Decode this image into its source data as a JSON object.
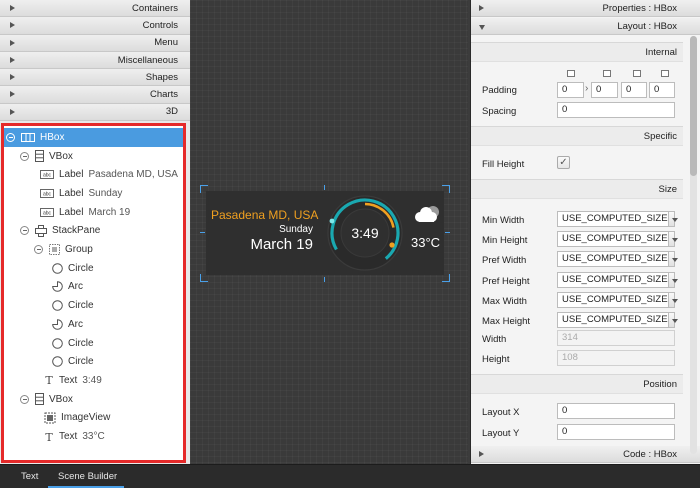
{
  "library": {
    "sections": [
      "Containers",
      "Controls",
      "Menu",
      "Miscellaneous",
      "Shapes",
      "Charts",
      "3D"
    ]
  },
  "hierarchy": {
    "items": [
      {
        "name": "HBox",
        "value": ""
      },
      {
        "name": "VBox",
        "value": ""
      },
      {
        "name": "Label",
        "value": "Pasadena MD, USA"
      },
      {
        "name": "Label",
        "value": "Sunday"
      },
      {
        "name": "Label",
        "value": "March 19"
      },
      {
        "name": "StackPane",
        "value": ""
      },
      {
        "name": "Group",
        "value": ""
      },
      {
        "name": "Circle",
        "value": ""
      },
      {
        "name": "Arc",
        "value": ""
      },
      {
        "name": "Circle",
        "value": ""
      },
      {
        "name": "Arc",
        "value": ""
      },
      {
        "name": "Circle",
        "value": ""
      },
      {
        "name": "Circle",
        "value": ""
      },
      {
        "name": "Text",
        "value": "3:49"
      },
      {
        "name": "VBox",
        "value": ""
      },
      {
        "name": "ImageView",
        "value": ""
      },
      {
        "name": "Text",
        "value": "33°C"
      }
    ],
    "icon_labels": {
      "label": "abc"
    }
  },
  "preview": {
    "city": "Pasadena MD, USA",
    "day": "Sunday",
    "date": "March 19",
    "time": "3:49",
    "temperature": "33°C",
    "colors": {
      "city": "#f0a020",
      "arc_orange": "#f0a020",
      "ring_teal": "#1aa8b0",
      "background": "#2f2f2f"
    }
  },
  "inspector": {
    "properties_header": "Properties : HBox",
    "layout_header": "Layout : HBox",
    "code_header": "Code : HBox",
    "sections": {
      "internal": "Internal",
      "specific": "Specific",
      "size": "Size",
      "position": "Position"
    },
    "padding": {
      "label": "Padding",
      "top": "0",
      "right": "0",
      "bottom": "0",
      "left": "0"
    },
    "spacing": {
      "label": "Spacing",
      "value": "0"
    },
    "fill_height": {
      "label": "Fill Height",
      "checked": true
    },
    "size_rows": [
      {
        "label": "Min Width",
        "value": "USE_COMPUTED_SIZE"
      },
      {
        "label": "Min Height",
        "value": "USE_COMPUTED_SIZE"
      },
      {
        "label": "Pref Width",
        "value": "USE_COMPUTED_SIZE"
      },
      {
        "label": "Pref Height",
        "value": "USE_COMPUTED_SIZE"
      },
      {
        "label": "Max Width",
        "value": "USE_COMPUTED_SIZE"
      },
      {
        "label": "Max Height",
        "value": "USE_COMPUTED_SIZE"
      }
    ],
    "width": {
      "label": "Width",
      "value": "314"
    },
    "height": {
      "label": "Height",
      "value": "108"
    },
    "layout_x": {
      "label": "Layout X",
      "value": "0"
    },
    "layout_y": {
      "label": "Layout Y",
      "value": "0"
    }
  },
  "bottom_tabs": {
    "text": "Text",
    "scene_builder": "Scene Builder"
  }
}
